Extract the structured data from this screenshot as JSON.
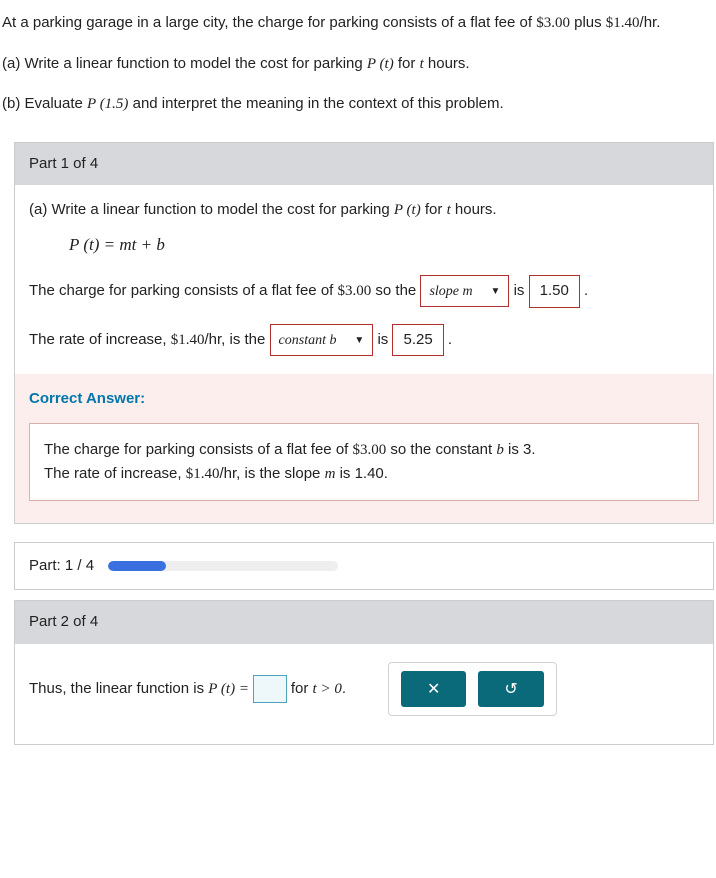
{
  "preamble": {
    "intro_part1": "At a parking garage in a large city, the charge for parking consists of a flat fee of ",
    "flat_fee": "$3.00",
    "intro_part2": " plus ",
    "rate": "$1.40",
    "intro_part3": "/hr.",
    "qa_pre": "(a) Write a linear function to model the cost for parking ",
    "qa_func": "P (t)",
    "qa_mid": " for ",
    "qa_var": "t",
    "qa_post": " hours.",
    "qb_pre": "(b) Evaluate ",
    "qb_func": "P (1.5)",
    "qb_post": " and interpret the meaning in the context of this problem."
  },
  "part1": {
    "header": "Part 1 of 4",
    "line_a_pre": "(a) Write a linear function to model the cost for parking ",
    "line_a_func": "P (t)",
    "line_a_mid": " for ",
    "line_a_var": "t",
    "line_a_post": " hours.",
    "equation": "P (t) = mt + b",
    "row1_pre": "The charge for parking consists of a flat fee of ",
    "row1_fee": "$3.00",
    "row1_mid": " so the ",
    "row1_select": "slope m",
    "row1_is": "is",
    "row1_val": "1.50",
    "row1_post": ".",
    "row2_pre": "The rate of increase, ",
    "row2_rate": "$1.40",
    "row2_mid": "/hr, is the ",
    "row2_select": "constant b",
    "row2_is": "is",
    "row2_val": "5.25",
    "row2_post": ".",
    "correct_label": "Correct Answer:",
    "correct_l1_pre": "The charge for parking consists of a flat fee of ",
    "correct_l1_fee": "$3.00",
    "correct_l1_mid": " so the constant ",
    "correct_l1_var": "b",
    "correct_l1_post": " is 3.",
    "correct_l2_pre": "The rate of increase, ",
    "correct_l2_rate": "$1.40",
    "correct_l2_mid": "/hr, is the slope ",
    "correct_l2_var": "m",
    "correct_l2_post": " is 1.40."
  },
  "progress": {
    "label": "Part: 1 / 4",
    "fill_pct": 25
  },
  "part2": {
    "header": "Part 2 of 4",
    "pre": "Thus, the linear function is ",
    "func": "P (t) = ",
    "mid": " for ",
    "cond": "t > 0",
    "post": "."
  }
}
